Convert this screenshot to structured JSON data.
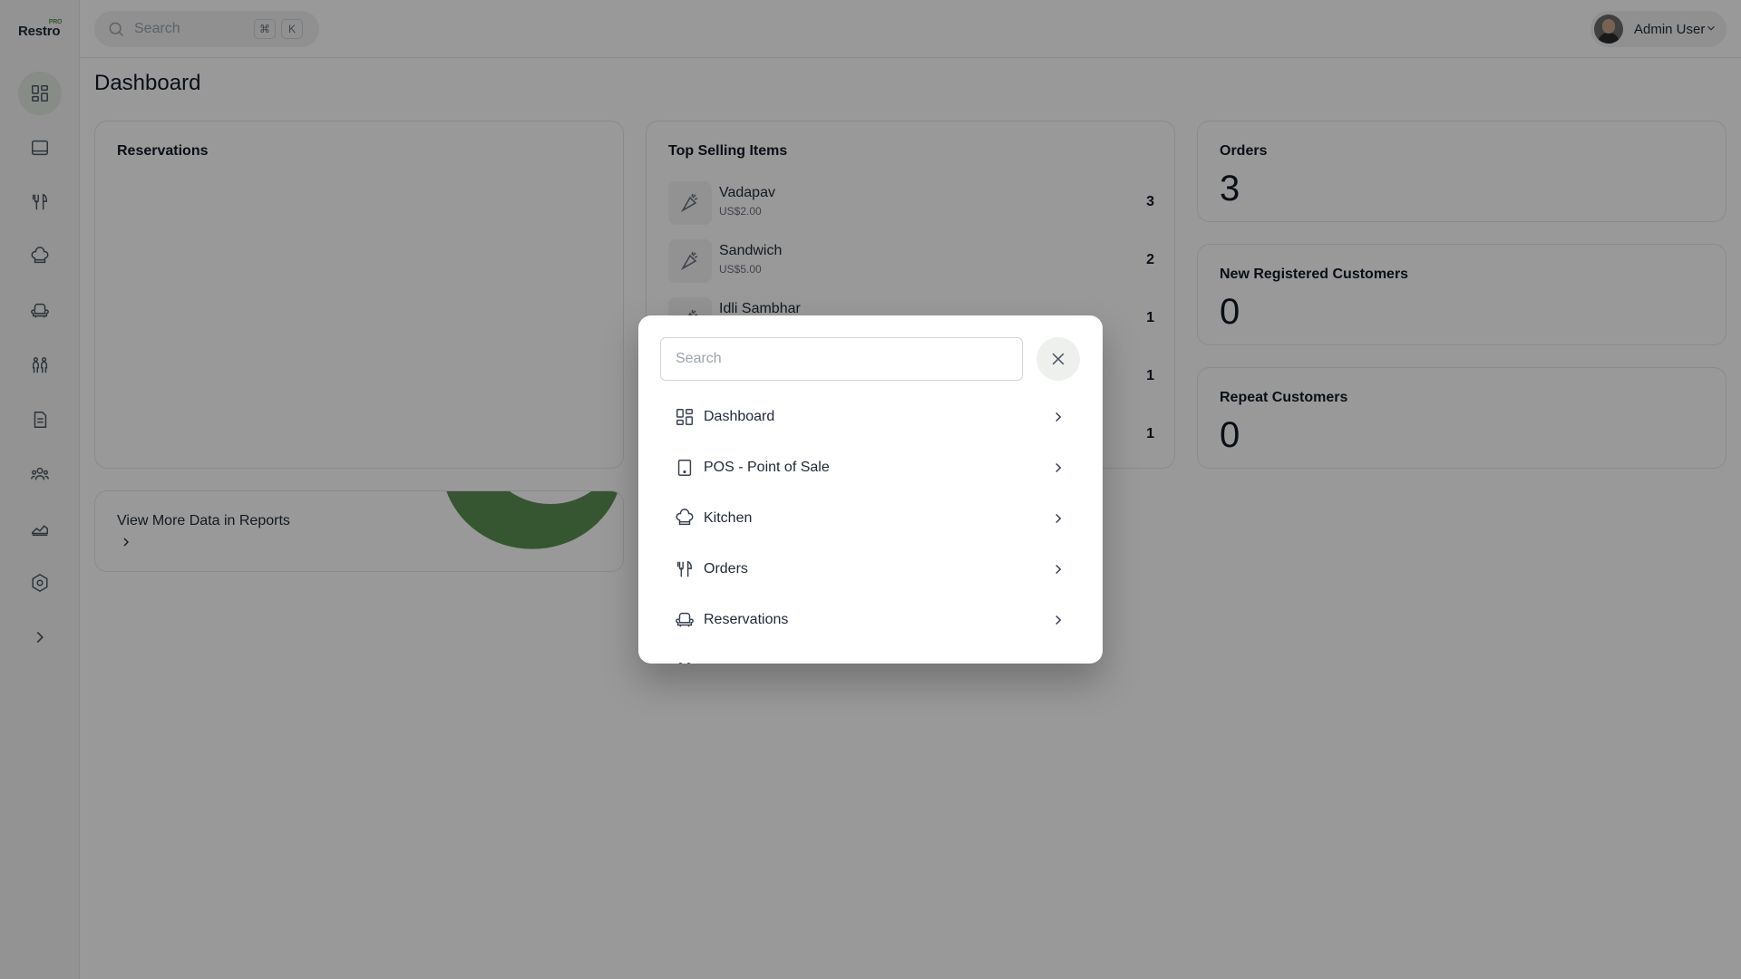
{
  "app": {
    "logo": "Restro",
    "logo_badge": "PRO"
  },
  "sidebar": {
    "items": [
      {
        "icon": "dashboard-icon",
        "active": true
      },
      {
        "icon": "pos-icon"
      },
      {
        "icon": "orders-icon"
      },
      {
        "icon": "kitchen-icon"
      },
      {
        "icon": "reservations-icon"
      },
      {
        "icon": "users-icon"
      },
      {
        "icon": "invoice-icon"
      },
      {
        "icon": "customers-icon"
      },
      {
        "icon": "reports-icon"
      },
      {
        "icon": "settings-icon"
      },
      {
        "icon": "expand-icon"
      }
    ]
  },
  "topbar": {
    "search_placeholder": "Search",
    "shortcut_mod": "⌘",
    "shortcut_key": "K",
    "user_name": "Admin User"
  },
  "page": {
    "title": "Dashboard"
  },
  "reservations_card": {
    "title": "Reservations"
  },
  "reports_card": {
    "label": "View More Data in Reports"
  },
  "top_selling": {
    "title": "Top Selling Items",
    "items": [
      {
        "name": "Vadapav",
        "price": "US$2.00",
        "count": "3"
      },
      {
        "name": "Sandwich",
        "price": "US$5.00",
        "count": "2"
      },
      {
        "name": "Idli Sambhar",
        "price": "",
        "count": "1"
      },
      {
        "name": "",
        "price": "",
        "count": "1"
      },
      {
        "name": "",
        "price": "",
        "count": "1"
      }
    ]
  },
  "stats": {
    "orders": {
      "title": "Orders",
      "value": "3"
    },
    "new_customers": {
      "title": "New Registered Customers",
      "value": "0"
    },
    "repeat_customers": {
      "title": "Repeat Customers",
      "value": "0"
    }
  },
  "colors": {
    "accent": "#5b8f52",
    "overlay": "rgba(0,0,0,0.4)"
  },
  "modal": {
    "search_placeholder": "Search",
    "items": [
      {
        "label": "Dashboard",
        "icon": "dashboard-icon"
      },
      {
        "label": "POS - Point of Sale",
        "icon": "pos-icon"
      },
      {
        "label": "Kitchen",
        "icon": "kitchen-icon"
      },
      {
        "label": "Orders",
        "icon": "orders-icon"
      },
      {
        "label": "Reservations",
        "icon": "reservations-icon"
      }
    ]
  }
}
